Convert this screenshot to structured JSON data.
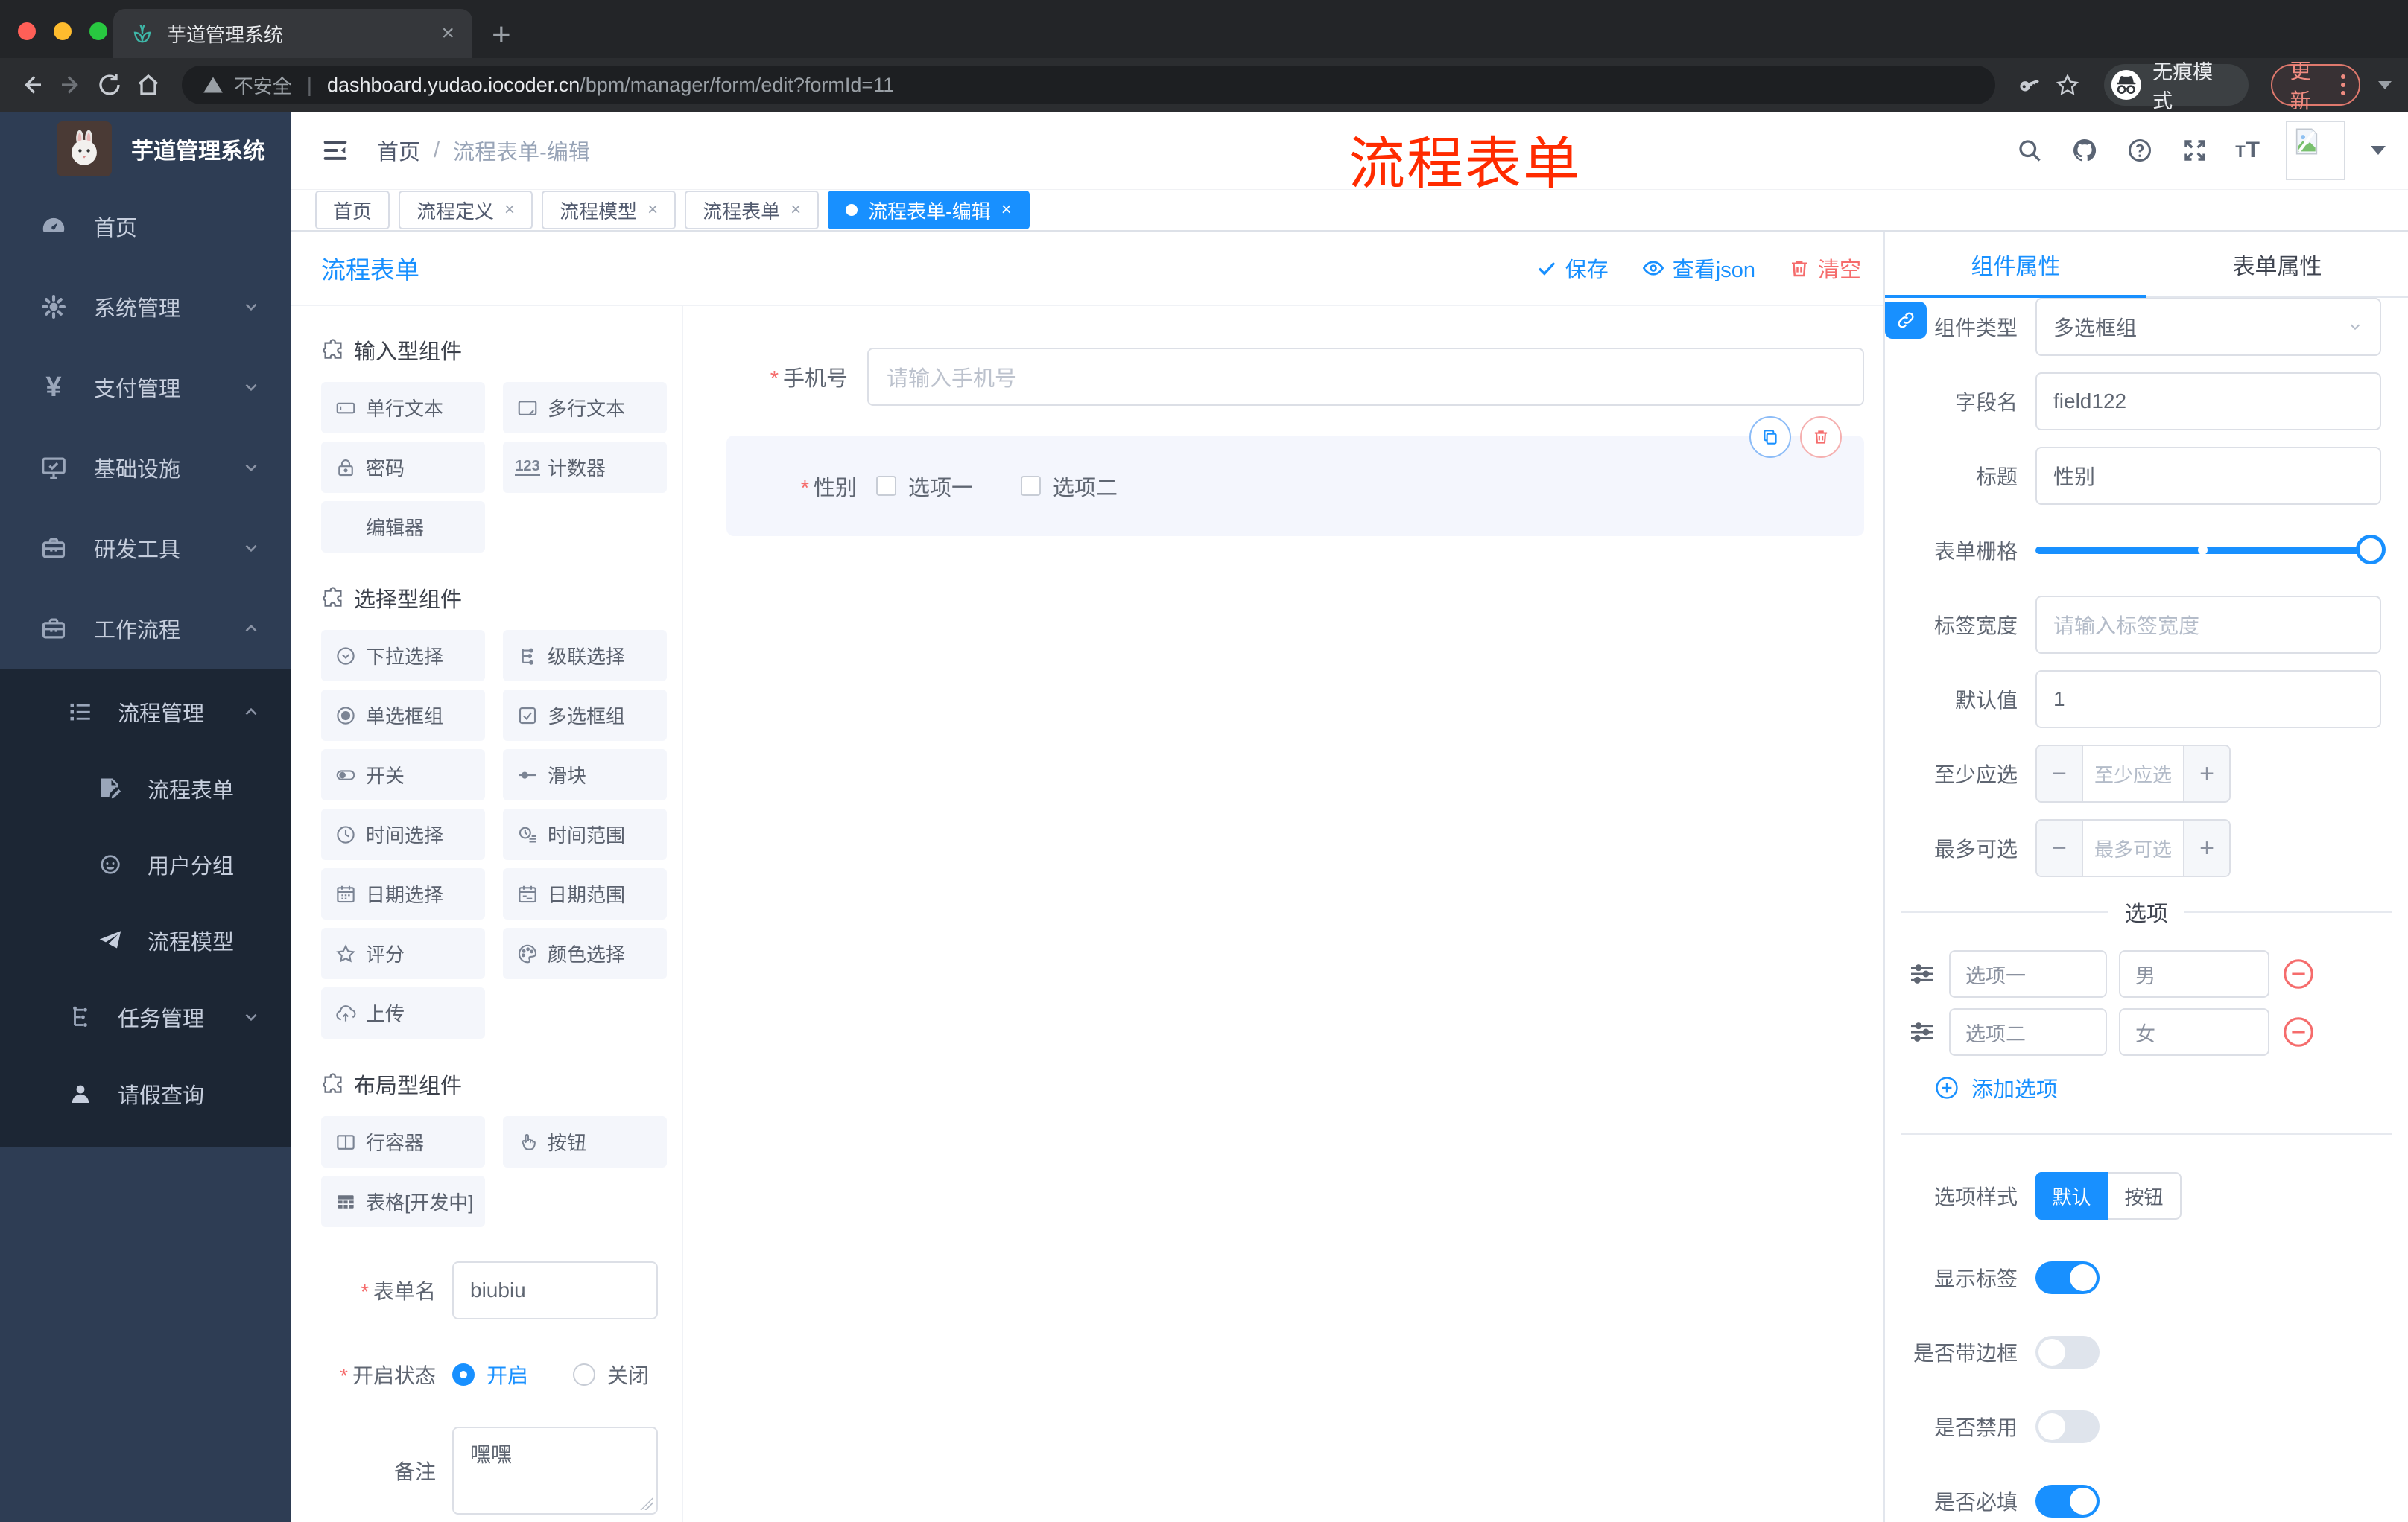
{
  "browser": {
    "tab_title": "芋道管理系统",
    "security_label": "不安全",
    "url_host": "dashboard.yudao.iocoder.cn",
    "url_path": "/bpm/manager/form/edit?formId=11",
    "incognito_label": "无痕模式",
    "update_label": "更新"
  },
  "annotation": {
    "text": "流程表单",
    "color": "#ff2b00"
  },
  "sidebar": {
    "logo_title": "芋道管理系统",
    "items": [
      {
        "icon": "dashboard-icon",
        "label": "首页"
      },
      {
        "icon": "gear-icon",
        "label": "系统管理"
      },
      {
        "icon": "yen-icon",
        "label": "支付管理"
      },
      {
        "icon": "monitor-icon",
        "label": "基础设施"
      },
      {
        "icon": "toolbox-icon",
        "label": "研发工具"
      },
      {
        "icon": "briefcase-icon",
        "label": "工作流程"
      }
    ],
    "sub": [
      {
        "icon": "list-icon",
        "label": "流程管理"
      },
      {
        "icon": "form-doc-icon",
        "label": "流程表单"
      },
      {
        "icon": "robot-icon",
        "label": "用户分组"
      },
      {
        "icon": "paper-plane-icon",
        "label": "流程模型"
      },
      {
        "icon": "tree-icon",
        "label": "任务管理"
      },
      {
        "icon": "person-icon",
        "label": "请假查询"
      }
    ]
  },
  "header": {
    "breadcrumb_home": "首页",
    "breadcrumb_sep": "/",
    "breadcrumb_current": "流程表单-编辑"
  },
  "pagetabs": [
    {
      "label": "首页"
    },
    {
      "label": "流程定义"
    },
    {
      "label": "流程模型"
    },
    {
      "label": "流程表单"
    },
    {
      "label": "流程表单-编辑"
    }
  ],
  "toolbar": {
    "title": "流程表单",
    "save_label": "保存",
    "view_json_label": "查看json",
    "clear_label": "清空"
  },
  "palette": {
    "sections": [
      {
        "title": "输入型组件",
        "items": [
          {
            "icon": "input-icon",
            "label": "单行文本"
          },
          {
            "icon": "textarea-icon",
            "label": "多行文本"
          },
          {
            "icon": "lock-icon",
            "label": "密码"
          },
          {
            "icon": "counter-icon",
            "label": "计数器"
          },
          {
            "icon": "none",
            "label": "编辑器"
          }
        ]
      },
      {
        "title": "选择型组件",
        "items": [
          {
            "icon": "select-icon",
            "label": "下拉选择"
          },
          {
            "icon": "cascader-icon",
            "label": "级联选择"
          },
          {
            "icon": "radio-icon",
            "label": "单选框组"
          },
          {
            "icon": "checkbox-icon",
            "label": "多选框组"
          },
          {
            "icon": "switch-icon",
            "label": "开关"
          },
          {
            "icon": "slider-icon",
            "label": "滑块"
          },
          {
            "icon": "time-icon",
            "label": "时间选择"
          },
          {
            "icon": "time-range-icon",
            "label": "时间范围"
          },
          {
            "icon": "date-icon",
            "label": "日期选择"
          },
          {
            "icon": "date-range-icon",
            "label": "日期范围"
          },
          {
            "icon": "star-icon",
            "label": "评分"
          },
          {
            "icon": "palette-icon",
            "label": "颜色选择"
          },
          {
            "icon": "upload-icon",
            "label": "上传"
          }
        ]
      },
      {
        "title": "布局型组件",
        "items": [
          {
            "icon": "columns-icon",
            "label": "行容器"
          },
          {
            "icon": "hand-icon",
            "label": "按钮"
          },
          {
            "icon": "table-icon",
            "label": "表格[开发中]"
          }
        ]
      }
    ]
  },
  "form_settings": {
    "name_label": "表单名",
    "name_value": "biubiu",
    "status_label": "开启状态",
    "status_on": "开启",
    "status_off": "关闭",
    "remark_label": "备注",
    "remark_value": "嘿嘿"
  },
  "canvas": {
    "phone_label": "手机号",
    "phone_placeholder": "请输入手机号",
    "gender_label": "性别",
    "gender_options": [
      "选项一",
      "选项二"
    ]
  },
  "panel": {
    "tabs": [
      "组件属性",
      "表单属性"
    ],
    "component_type_label": "组件类型",
    "component_type_value": "多选框组",
    "field_name_label": "字段名",
    "field_name_value": "field122",
    "title_label": "标题",
    "title_value": "性别",
    "grid_label": "表单栅格",
    "label_width_label": "标签宽度",
    "label_width_placeholder": "请输入标签宽度",
    "default_label": "默认值",
    "default_value": "1",
    "min_label": "至少应选",
    "min_placeholder": "至少应选",
    "max_label": "最多可选",
    "max_placeholder": "最多可选",
    "options_divider": "选项",
    "options": [
      {
        "label": "选项一",
        "value": "男"
      },
      {
        "label": "选项二",
        "value": "女"
      }
    ],
    "add_option_label": "添加选项",
    "style_label": "选项样式",
    "style_default": "默认",
    "style_button": "按钮",
    "show_label_label": "显示标签",
    "border_label": "是否带边框",
    "disabled_label": "是否禁用",
    "required_label": "是否必填"
  }
}
